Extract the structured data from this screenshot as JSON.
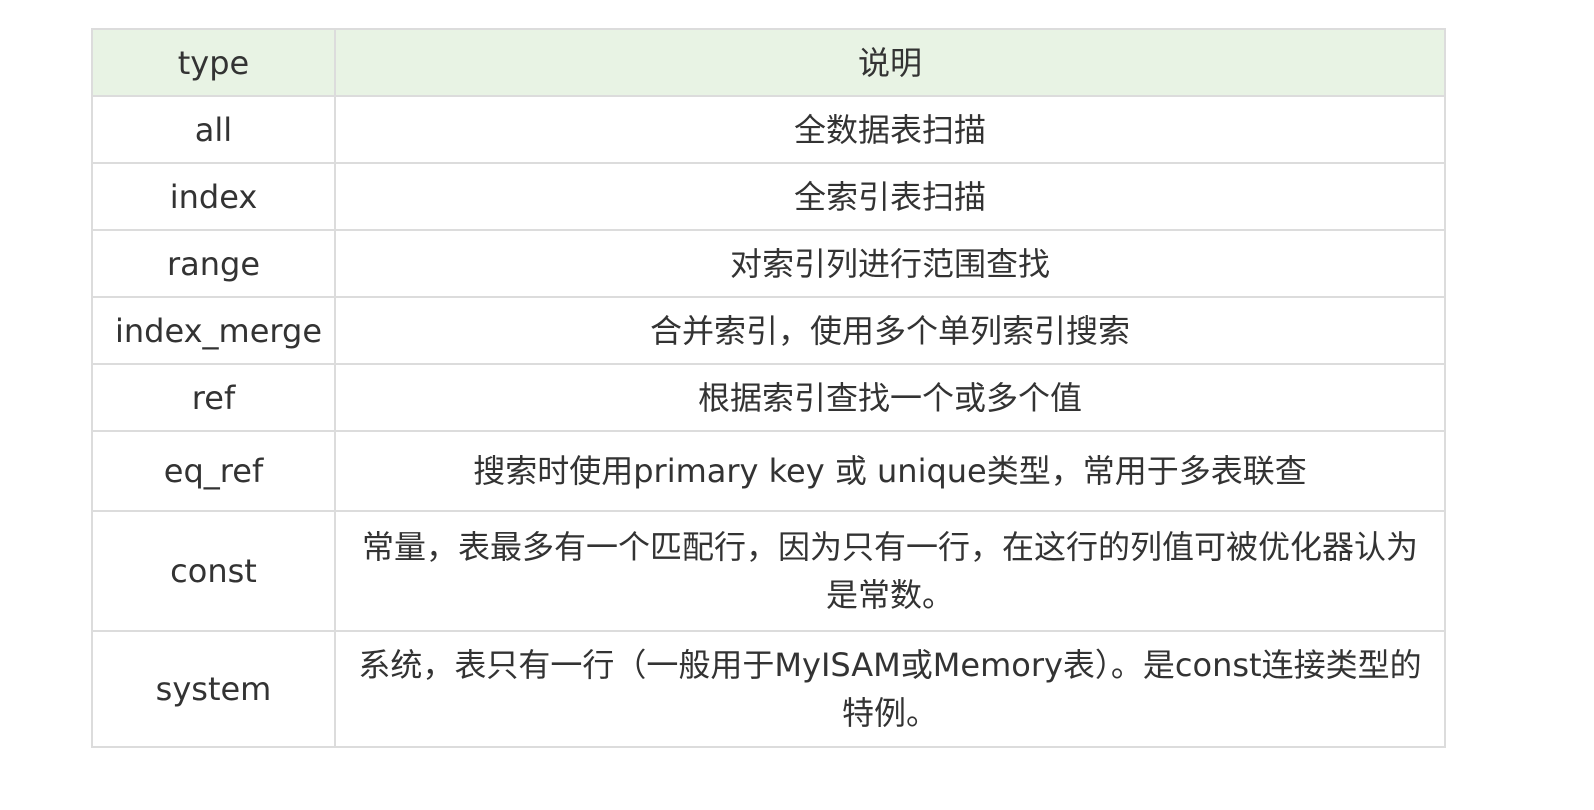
{
  "table": {
    "headers": [
      "type",
      "说明"
    ],
    "rows": [
      {
        "type": "all",
        "desc": "全数据表扫描"
      },
      {
        "type": "index",
        "desc": "全索引表扫描"
      },
      {
        "type": "range",
        "desc": "对索引列进行范围查找"
      },
      {
        "type": "index_merge",
        "desc": "合并索引，使用多个单列索引搜索"
      },
      {
        "type": "ref",
        "desc": "根据索引查找一个或多个值"
      },
      {
        "type": "eq_ref",
        "desc": "搜索时使用primary key 或 unique类型，常用于多表联查"
      },
      {
        "type": "const",
        "desc": "常量，表最多有一个匹配行，因为只有一行，在这行的列值可被优化器认为是常数。"
      },
      {
        "type": "system",
        "desc": "系统，表只有一行（一般用于MyISAM或Memory表）。是const连接类型的特例。"
      }
    ]
  }
}
